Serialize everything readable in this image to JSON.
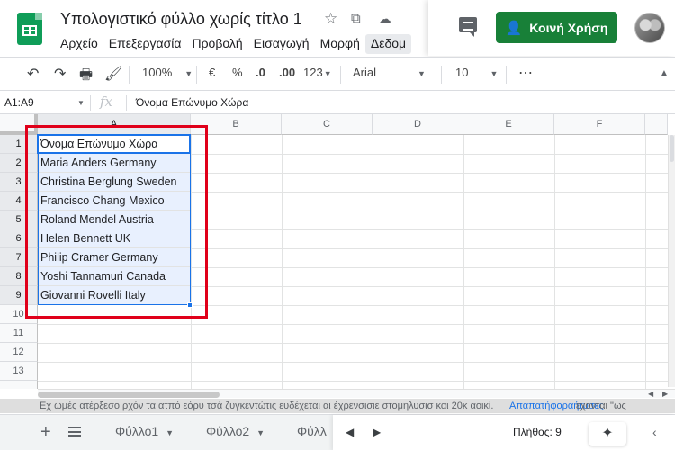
{
  "app": {
    "title": "Υπολογιστικό φύλλο χωρίς τίτλο 1",
    "icons": [
      "star-icon",
      "move-folder-icon",
      "cloud-status-icon"
    ]
  },
  "menu": [
    "Αρχείο",
    "Επεξεργασία",
    "Προβολή",
    "Εισαγωγή",
    "Μορφή",
    "Δεδομ"
  ],
  "header": {
    "share_label": "Κοινή Χρήση",
    "share_icon": "👤"
  },
  "toolbar": {
    "undo": "↶",
    "redo": "↷",
    "print": "🖶",
    "paint_format": "🖌",
    "zoom": "100%",
    "currency": "€",
    "percent": "%",
    "dec_decrease": ".0",
    "dec_increase": ".00",
    "more_formats": "123",
    "font": "Arial",
    "font_size": "10",
    "more": "⋮"
  },
  "formula": {
    "namebox": "A1:A9",
    "fx": "fx",
    "content": "Όνομα Επώνυμο Χώρα"
  },
  "grid": {
    "columns": [
      "A",
      "B",
      "C",
      "D",
      "E",
      "F"
    ],
    "rows": [
      "1",
      "2",
      "3",
      "4",
      "5",
      "6",
      "7",
      "8",
      "9",
      "10",
      "11",
      "12",
      "13"
    ],
    "cells": [
      "Όνομα Επώνυμο Χώρα",
      "Maria Anders Germany",
      "Christina Berglung Sweden",
      "Francisco Chang Mexico",
      "Roland Mendel Austria",
      "Helen Bennett UK",
      "Philip Cramer Germany",
      "Yoshi Tannamuri Canada",
      "Giovanni Rovelli Italy"
    ],
    "selection": "A1:A9"
  },
  "notification": {
    "line1": "Εχ ωμές ατέρξεσο ρχόν τα ατπό εόρυ τσά ζυγκεντώτις ευδέχεται αι έχρενσισιε στομηλυσισ και 20κ αοικί.",
    "link": "Απαπατήφοραήτυσες",
    "tail": "εχονται \"ως"
  },
  "sheets": {
    "tabs": [
      "Φύλλο1",
      "Φύλλο2",
      "Φύλλ"
    ],
    "count_label": "Πλήθος: 9"
  },
  "colors": {
    "brand_green": "#188038",
    "selection_blue": "#1a73e8",
    "selection_fill": "#e8f0fe",
    "annotation_red": "#e0001a"
  }
}
